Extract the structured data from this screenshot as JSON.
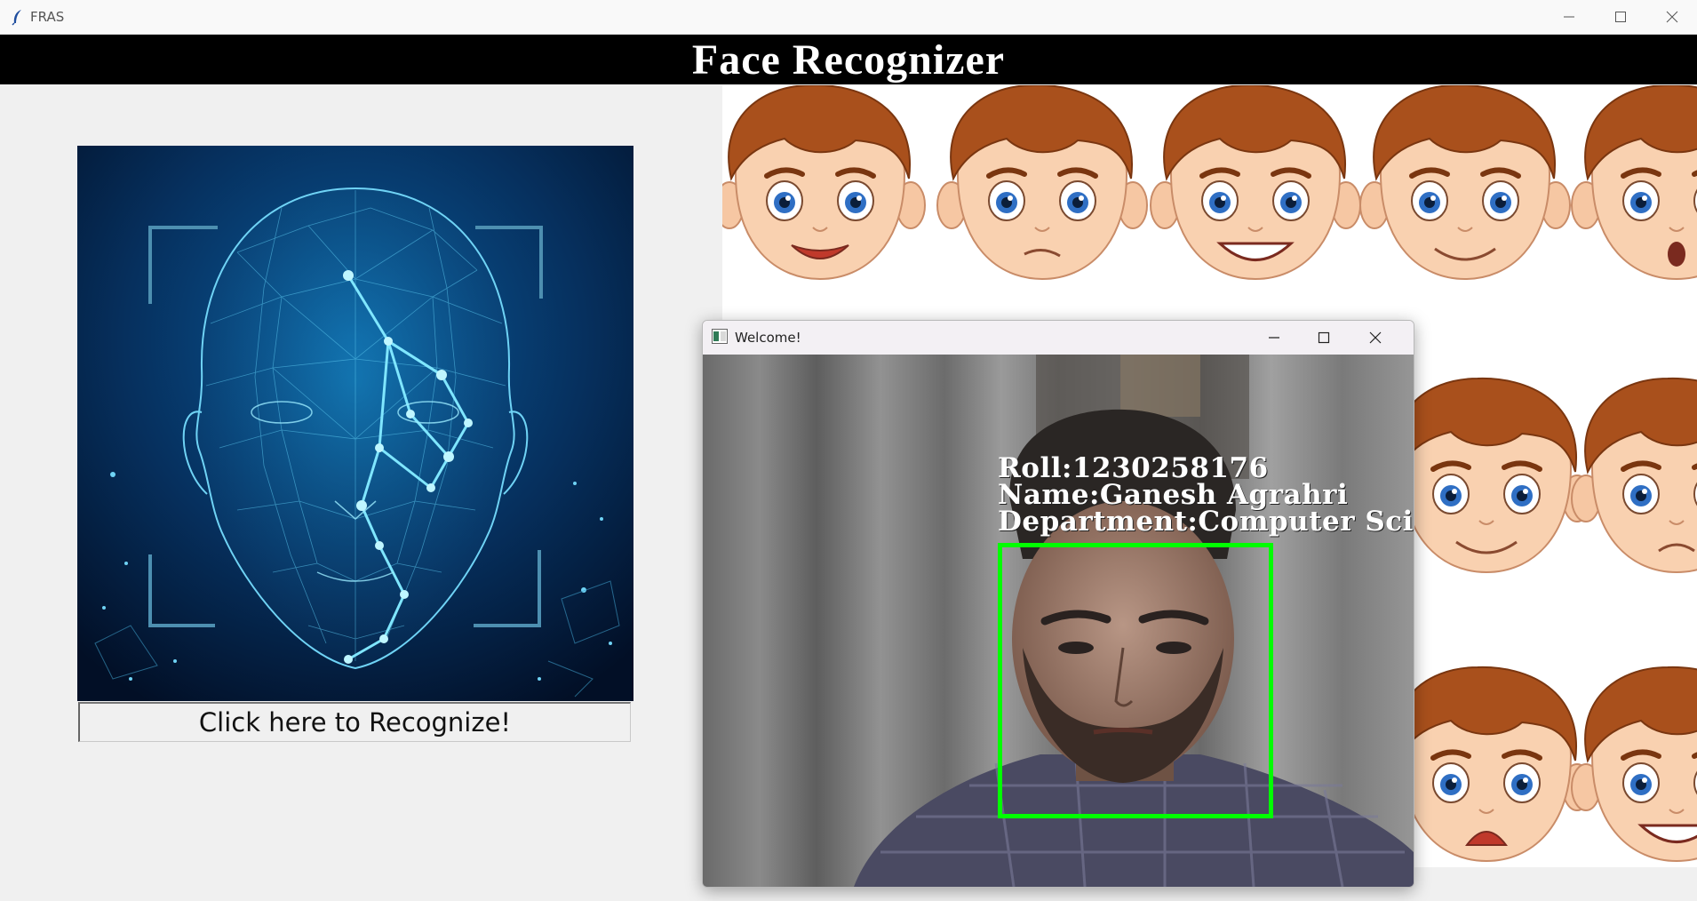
{
  "window": {
    "title": "FRAS",
    "controls": [
      "minimize-icon",
      "maximize-icon",
      "close-icon"
    ]
  },
  "banner": {
    "title": "Face Recognizer"
  },
  "left_panel": {
    "image": "face-mesh-illustration",
    "recognize_button_label": "Click here to Recognize!"
  },
  "right_panel": {
    "image": "cartoon-face-expressions"
  },
  "popup": {
    "title": "Welcome!",
    "controls": [
      "minimize-icon",
      "maximize-icon",
      "close-icon"
    ],
    "overlay": {
      "roll": "Roll:1230258176",
      "name": "Name:Ganesh Agrahri",
      "department": "Department:Computer Scie"
    },
    "face_box_color": "#00ff00"
  },
  "colors": {
    "banner_bg": "#000000",
    "banner_text": "#ffffff",
    "window_bg": "#f0f0f0"
  }
}
